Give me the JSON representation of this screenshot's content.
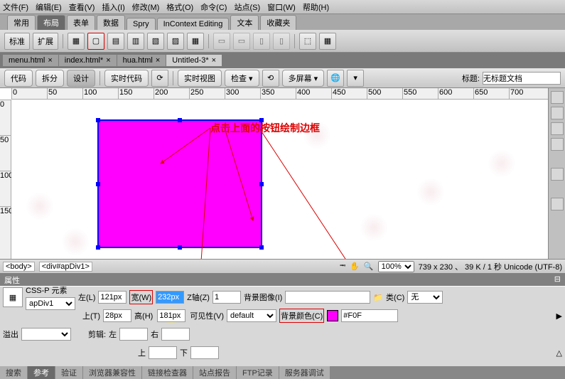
{
  "menubar": [
    "文件(F)",
    "编辑(E)",
    "查看(V)",
    "插入(I)",
    "修改(M)",
    "格式(O)",
    "命令(C)",
    "站点(S)",
    "窗口(W)",
    "帮助(H)"
  ],
  "ribbon_tabs": [
    "常用",
    "布局",
    "表单",
    "数据",
    "Spry",
    "InContext Editing",
    "文本",
    "收藏夹"
  ],
  "ribbon_active": 1,
  "toolbar_btns": [
    "标准",
    "扩展"
  ],
  "doc_tabs": [
    {
      "label": "menu.html",
      "dirty": false
    },
    {
      "label": "index.html*",
      "dirty": true
    },
    {
      "label": "hua.html",
      "dirty": false
    },
    {
      "label": "Untitled-3*",
      "dirty": true
    }
  ],
  "doc_active": 3,
  "view_btns": {
    "code": "代码",
    "split": "拆分",
    "design": "设计",
    "live": "实时代码",
    "liveview": "实时视图",
    "check": "检查",
    "multi": "多屏幕"
  },
  "title_label": "标题:",
  "title_value": "无标题文档",
  "ruler_h": [
    "0",
    "50",
    "100",
    "150",
    "200",
    "250",
    "300",
    "350",
    "400",
    "450",
    "500",
    "550",
    "600",
    "650",
    "700"
  ],
  "ruler_v": [
    "0",
    "50",
    "100",
    "150"
  ],
  "annotation": "点击上面的按钮绘制边框",
  "breadcrumb": [
    "<body>",
    "<div#apDiv1>"
  ],
  "zoom": "100%",
  "status": "739 x 230 、 39 K / 1 秒  Unicode (UTF-8)",
  "props": {
    "header": "属性",
    "csspLabel": "CSS-P 元素",
    "idValue": "apDiv1",
    "leftLabel": "左(L)",
    "leftValue": "121px",
    "widthLabel": "宽(W)",
    "widthValue": "232px",
    "zLabel": "Z轴(Z)",
    "zValue": "1",
    "bgimgLabel": "背景图像(I)",
    "bgimgValue": "",
    "classLabel": "类(C)",
    "classValue": "无",
    "topLabel": "上(T)",
    "topValue": "28px",
    "heightLabel": "高(H)",
    "heightValue": "181px",
    "visLabel": "可见性(V)",
    "visValue": "default",
    "bgcolorLabel": "背景颜色(C)",
    "bgcolorValue": "#F0F",
    "overflowLabel": "溢出",
    "overflowValue": "",
    "clipLabel": "剪辑:",
    "clipL": "左",
    "clipR": "右",
    "clipT": "上",
    "clipB": "下"
  },
  "bottom_tabs": [
    "搜索",
    "参考",
    "验证",
    "浏览器兼容性",
    "链接检查器",
    "站点报告",
    "FTP记录",
    "服务器调试"
  ],
  "bottom_active": 1,
  "colors": {
    "magenta": "#ff00ff",
    "blue": "#0000ff"
  }
}
